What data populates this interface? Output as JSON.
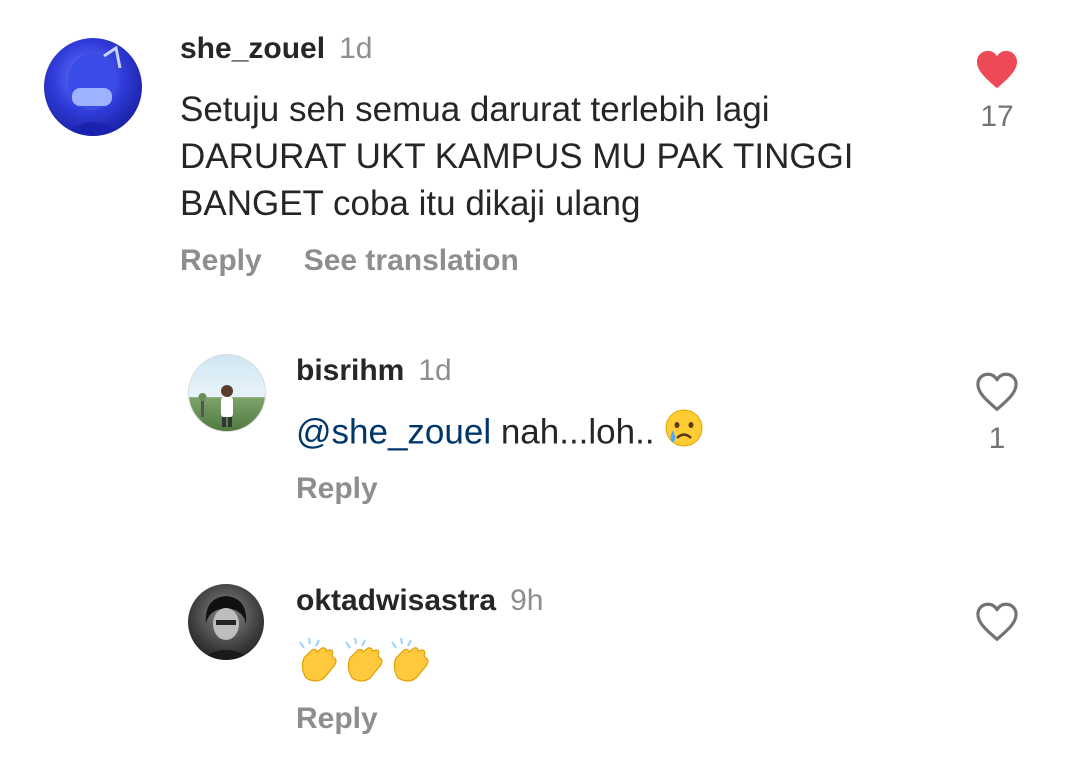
{
  "comments": [
    {
      "username": "she_zouel",
      "time": "1d",
      "text": "Setuju seh semua darurat terlebih lagi DARURAT UKT KAMPUS MU PAK TINGGI BANGET coba itu dikaji ulang",
      "actions": [
        "Reply",
        "See translation"
      ],
      "likes": "17",
      "liked": true,
      "avatar_icon": "avatar-blue-selfie"
    },
    {
      "username": "bisrihm",
      "time": "1d",
      "mention": "@she_zouel",
      "text": " nah...loh..",
      "emoji": "crying-face",
      "actions": [
        "Reply"
      ],
      "likes": "1",
      "liked": false,
      "avatar_icon": "avatar-outdoor-photo"
    },
    {
      "username": "oktadwisastra",
      "time": "9h",
      "emoji": [
        "clapping-hands",
        "clapping-hands",
        "clapping-hands"
      ],
      "actions": [
        "Reply"
      ],
      "likes": "",
      "liked": false,
      "avatar_icon": "avatar-bw-portrait"
    }
  ],
  "colors": {
    "heart_liked": "#ed4956",
    "mention": "#00376b",
    "secondary_text": "#8e8e8e"
  }
}
